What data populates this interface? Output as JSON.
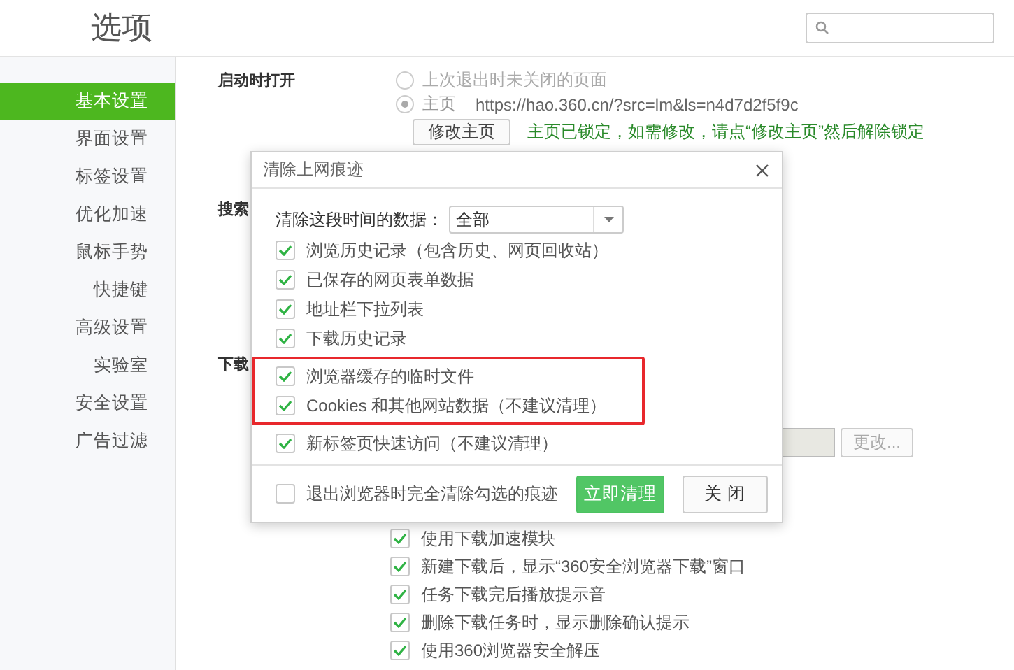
{
  "window": {
    "title": "选项"
  },
  "sidebar": {
    "items": [
      {
        "label": "基本设置",
        "selected": true
      },
      {
        "label": "界面设置",
        "selected": false
      },
      {
        "label": "标签设置",
        "selected": false
      },
      {
        "label": "优化加速",
        "selected": false
      },
      {
        "label": "鼠标手势",
        "selected": false
      },
      {
        "label": "快捷键",
        "selected": false
      },
      {
        "label": "高级设置",
        "selected": false
      },
      {
        "label": "实验室",
        "selected": false
      },
      {
        "label": "安全设置",
        "selected": false
      },
      {
        "label": "广告过滤",
        "selected": false
      }
    ]
  },
  "startup": {
    "label": "启动时打开",
    "options": [
      {
        "label": "上次退出时未关闭的页面",
        "selected": false
      },
      {
        "label": "主页",
        "url": "https://hao.360.cn/?src=lm&ls=n4d7d2f5f9c",
        "selected": true
      }
    ],
    "button": "修改主页",
    "note": "主页已锁定，如需修改，请点“修改主页”然后解除锁定"
  },
  "search_section": {
    "label": "搜索"
  },
  "download_section": {
    "label": "下载",
    "path_button": "更改...",
    "options": [
      {
        "label": "使用下载加速模块",
        "checked": true
      },
      {
        "label": "新建下载后，显示“360安全浏览器下载”窗口",
        "checked": true
      },
      {
        "label": "任务下载完后播放提示音",
        "checked": true
      },
      {
        "label": "删除下载任务时，显示删除确认提示",
        "checked": true
      },
      {
        "label": "使用360浏览器安全解压",
        "checked": true
      }
    ]
  },
  "dialog": {
    "title": "清除上网痕迹",
    "range_label": "清除这段时间的数据：",
    "range_value": "全部",
    "items": [
      {
        "label": "浏览历史记录（包含历史、网页回收站）",
        "checked": true,
        "highlighted": false
      },
      {
        "label": "已保存的网页表单数据",
        "checked": true,
        "highlighted": false
      },
      {
        "label": "地址栏下拉列表",
        "checked": true,
        "highlighted": false
      },
      {
        "label": "下载历史记录",
        "checked": true,
        "highlighted": false
      },
      {
        "label": "浏览器缓存的临时文件",
        "checked": true,
        "highlighted": true
      },
      {
        "label": "Cookies 和其他网站数据（不建议清理）",
        "checked": true,
        "highlighted": true
      },
      {
        "label": "新标签页快速访问（不建议清理）",
        "checked": true,
        "highlighted": false
      }
    ],
    "exit_option": {
      "label": "退出浏览器时完全清除勾选的痕迹",
      "checked": false
    },
    "buttons": [
      {
        "label": "立即清理",
        "kind": "primary"
      },
      {
        "label": "关 闭",
        "kind": "secondary"
      }
    ]
  }
}
